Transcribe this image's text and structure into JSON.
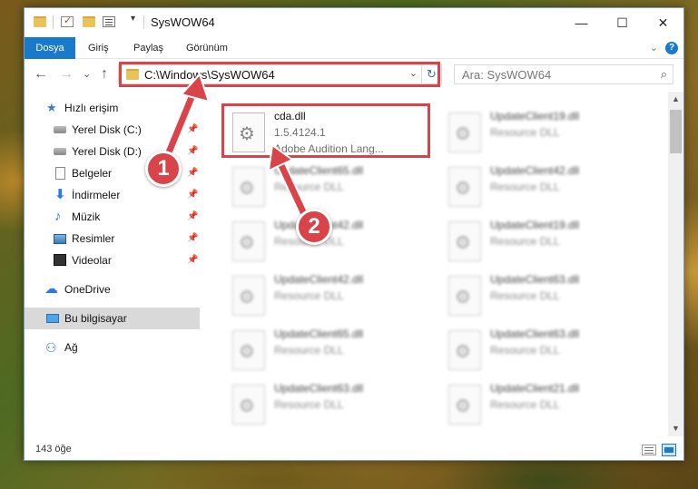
{
  "window": {
    "title": "SysWOW64",
    "minimize": "—",
    "maximize": "☐",
    "close": "✕"
  },
  "ribbon": {
    "tabs": [
      "Dosya",
      "Giriş",
      "Paylaş",
      "Görünüm"
    ],
    "chevron": "⌄",
    "help": "?"
  },
  "nav": {
    "back": "←",
    "forward": "→",
    "recent": "⌄",
    "up": "↑",
    "address": "C:\\Windows\\SysWOW64",
    "address_dropdown": "⌄",
    "refresh": "↻",
    "search_placeholder": "Ara: SysWOW64",
    "search_icon": "⌕"
  },
  "sidebar": {
    "items": [
      {
        "label": "Hızlı erişim",
        "icon": "star-icon",
        "glyph": "★",
        "pinned": false
      },
      {
        "label": "Yerel Disk (C:)",
        "icon": "drive-icon",
        "glyph": "",
        "pinned": true
      },
      {
        "label": "Yerel Disk (D:)",
        "icon": "drive-icon",
        "glyph": "",
        "pinned": true
      },
      {
        "label": "Belgeler",
        "icon": "document-icon",
        "glyph": "",
        "pinned": true
      },
      {
        "label": "İndirmeler",
        "icon": "download-icon",
        "glyph": "⬇",
        "pinned": true
      },
      {
        "label": "Müzik",
        "icon": "music-icon",
        "glyph": "♪",
        "pinned": true
      },
      {
        "label": "Resimler",
        "icon": "pictures-icon",
        "glyph": "",
        "pinned": true
      },
      {
        "label": "Videolar",
        "icon": "video-icon",
        "glyph": "",
        "pinned": true
      },
      {
        "label": "OneDrive",
        "icon": "cloud-icon",
        "glyph": "☁",
        "pinned": false
      },
      {
        "label": "Bu bilgisayar",
        "icon": "computer-icon",
        "glyph": "",
        "pinned": false,
        "selected": true
      },
      {
        "label": "Ağ",
        "icon": "network-icon",
        "glyph": "⚇",
        "pinned": false
      }
    ],
    "pin_glyph": "📌"
  },
  "files": [
    {
      "name": "cda.dll",
      "line2": "1.5.4124.1",
      "line3": "Adobe Audition Lang...",
      "highlighted": true
    },
    {
      "name": "UpdateClient65.dll",
      "line2": "Resource DLL",
      "line3": ""
    },
    {
      "name": "UpdateClient42.dll",
      "line2": "Resource DLL",
      "line3": ""
    },
    {
      "name": "UpdateClient42.dll",
      "line2": "Resource DLL",
      "line3": ""
    },
    {
      "name": "UpdateClient65.dll",
      "line2": "Resource DLL",
      "line3": ""
    },
    {
      "name": "UpdateClient63.dll",
      "line2": "Resource DLL",
      "line3": ""
    },
    {
      "name": "UpdateClient19.dll",
      "line2": "Resource DLL",
      "line3": ""
    },
    {
      "name": "UpdateClient42.dll",
      "line2": "Resource DLL",
      "line3": ""
    },
    {
      "name": "UpdateClient19.dll",
      "line2": "Resource DLL",
      "line3": ""
    },
    {
      "name": "UpdateClient63.dll",
      "line2": "Resource DLL",
      "line3": ""
    },
    {
      "name": "UpdateClient63.dll",
      "line2": "Resource DLL",
      "line3": ""
    },
    {
      "name": "UpdateClient21.dll",
      "line2": "Resource DLL",
      "line3": ""
    }
  ],
  "status": {
    "item_count": "143 öğe"
  },
  "annotations": {
    "badge1": "1",
    "badge2": "2",
    "color": "#d9444a"
  }
}
